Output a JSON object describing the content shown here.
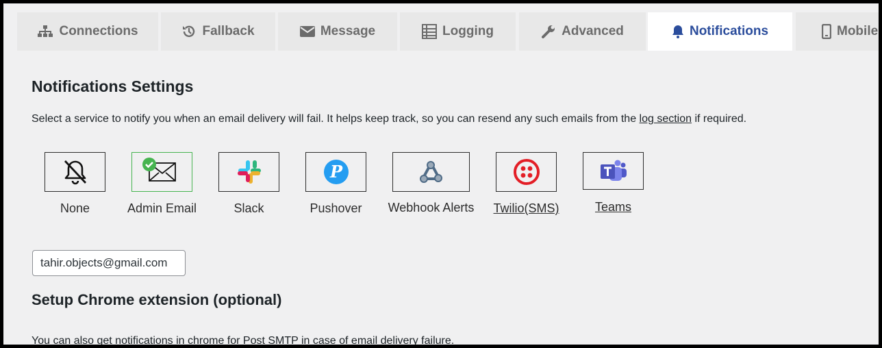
{
  "tabs": [
    {
      "label": "Connections",
      "icon": "sitemap-icon"
    },
    {
      "label": "Fallback",
      "icon": "history-icon"
    },
    {
      "label": "Message",
      "icon": "envelope-icon"
    },
    {
      "label": "Logging",
      "icon": "list-icon"
    },
    {
      "label": "Advanced",
      "icon": "wrench-icon"
    },
    {
      "label": "Notifications",
      "icon": "bell-icon",
      "active": true
    },
    {
      "label": "Mobile",
      "icon": "mobile-icon"
    }
  ],
  "page": {
    "title": "Notifications Settings",
    "desc_prefix": "Select a service to notify you when an email delivery will fail. It helps keep track, so you can resend any such emails from the ",
    "desc_link": "log section",
    "desc_suffix": " if required."
  },
  "services": [
    {
      "label": "None",
      "icon": "bell-slash-icon"
    },
    {
      "label": "Admin Email",
      "icon": "envelope-icon",
      "selected": true
    },
    {
      "label": "Slack",
      "icon": "slack-icon"
    },
    {
      "label": "Pushover",
      "icon": "pushover-icon"
    },
    {
      "label": "Webhook Alerts",
      "icon": "webhook-icon"
    },
    {
      "label": "Twilio(SMS)",
      "icon": "twilio-icon"
    },
    {
      "label": "Teams",
      "icon": "teams-icon"
    }
  ],
  "email_input": {
    "value": "tahir.objects@gmail.com"
  },
  "chrome": {
    "title": "Setup Chrome extension (optional)",
    "text": "You can also get notifications in chrome for Post SMTP in case of email delivery failure."
  },
  "colors": {
    "active_tab": "#2b4d9c",
    "selected_border": "#46b450",
    "bg": "#f0f0f1"
  }
}
